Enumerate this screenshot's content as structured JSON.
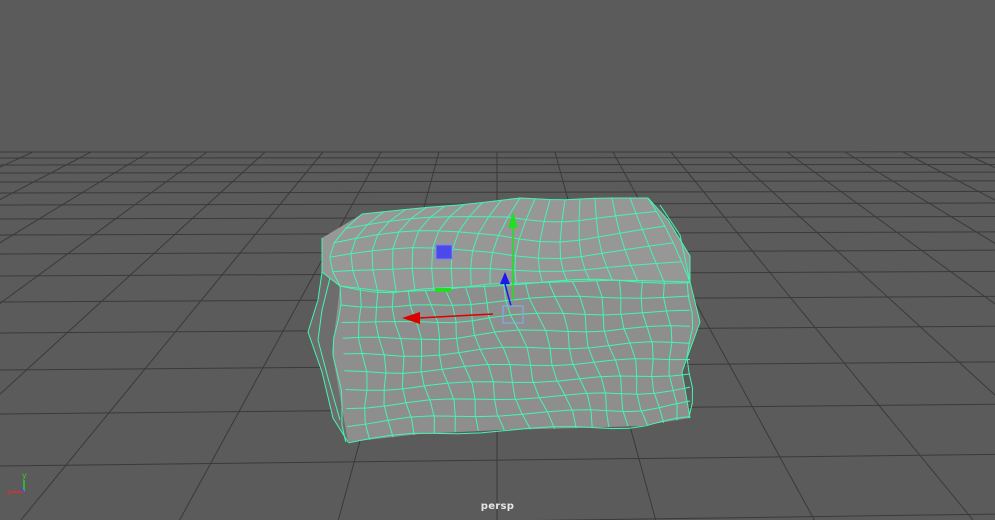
{
  "viewport": {
    "camera_name": "persp",
    "background_color": "#5b5b5b",
    "grid_color": "#3a3a3a",
    "wireframe_color": "#45f5b0",
    "surface_color": "#8c8c8c"
  },
  "manipulator": {
    "type": "move-tool",
    "x_axis_color": "#dd0000",
    "y_axis_color": "#22dd22",
    "z_axis_color": "#1a1aee",
    "center_handle_color": "#7fb0e0"
  },
  "axis_indicator": {
    "x_label": "x",
    "y_label": "y",
    "x_color": "#e03030",
    "y_color": "#30d030",
    "z_color": "#4040ff"
  }
}
